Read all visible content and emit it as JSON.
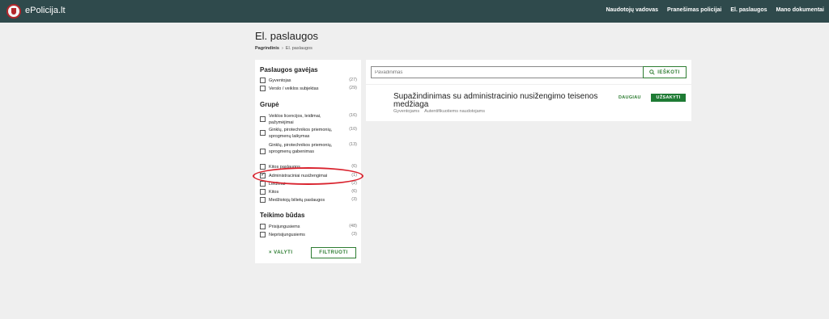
{
  "header": {
    "brand": "ePolicija.lt",
    "nav": [
      "Naudotojų vadovas",
      "Pranešimas policijai",
      "El. paslaugos",
      "Mano dokumentai"
    ]
  },
  "page": {
    "title": "El. paslaugos",
    "breadcrumb": [
      "Pagrindinis",
      "El. paslaugos"
    ]
  },
  "filters": {
    "provider": {
      "title": "Paslaugos gavėjas",
      "items": [
        {
          "label": "Gyventojas",
          "count": "(27)",
          "checked": false
        },
        {
          "label": "Verslo / veiklos subjektas",
          "count": "(29)",
          "checked": false
        }
      ]
    },
    "group": {
      "title": "Grupė",
      "items": [
        {
          "label": "Veiklos licencijos, leidimai, pažymėjimai",
          "count": "(16)",
          "checked": false
        },
        {
          "label": "Ginklų, pirotechnikos priemonių, sprogmenų laikymas",
          "count": "(10)",
          "checked": false
        },
        {
          "label": "Ginklų, pirotechnikos priemonių, sprogmenų gabenimas",
          "count": "(13)",
          "checked": false
        },
        {
          "label": "Kitos paslaugos",
          "count": "(6)",
          "checked": false
        },
        {
          "label": "Administraciniai nusižengimai",
          "count": "(1)",
          "checked": true
        },
        {
          "label": "Leidimai",
          "count": "(2)",
          "checked": false
        },
        {
          "label": "Kitos",
          "count": "(6)",
          "checked": false
        },
        {
          "label": "Medžiotojų bilietų paslaugos",
          "count": "(3)",
          "checked": false
        }
      ]
    },
    "method": {
      "title": "Teikimo būdas",
      "items": [
        {
          "label": "Prisijungusiems",
          "count": "(48)",
          "checked": false
        },
        {
          "label": "Neprisijungusiems",
          "count": "(3)",
          "checked": false
        }
      ]
    },
    "clear_label": "× VALYTI",
    "filter_label": "FILTRUOTI"
  },
  "search": {
    "placeholder": "Pavadinimas",
    "button_label": "IEŠKOTI"
  },
  "results": [
    {
      "title": "Supažindinimas su administracinio nusižengimo teisenos medžiaga",
      "tags": [
        "Gyventojams",
        "Autentifikuotiems naudotojams"
      ],
      "more_label": "DAUGIAU",
      "order_label": "UŽSAKYTI"
    }
  ],
  "colors": {
    "topbar": "#2f4a4c",
    "accent": "#2e7d32",
    "order_button": "#1e7b34",
    "annotation": "#d9232e"
  }
}
